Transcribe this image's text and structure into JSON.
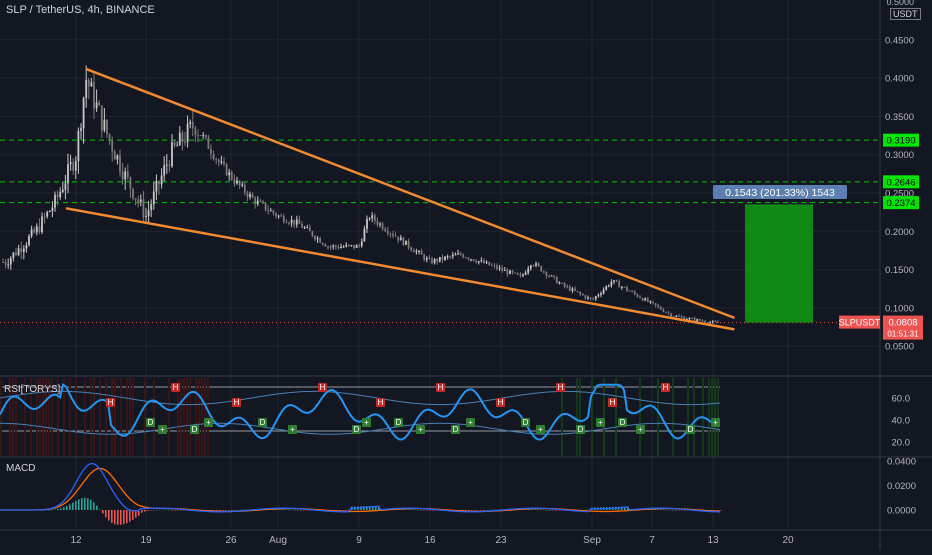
{
  "header": {
    "title": "SLP / TetherUS, 4h, BINANCE"
  },
  "price_axis": {
    "currency": "USDT",
    "ticks": [
      "0.4500",
      "0.4000",
      "0.3500",
      "0.3000",
      "0.2500",
      "0.2000",
      "0.1500",
      "0.1000",
      "0.0500"
    ],
    "tick_values": [
      0.45,
      0.4,
      0.35,
      0.3,
      0.25,
      0.2,
      0.15,
      0.1,
      0.05
    ],
    "top_partial": "0.5000"
  },
  "horizontal_levels": [
    {
      "value": "0.3190",
      "label_color": "#00e600"
    },
    {
      "value": "0.2646",
      "label_color": "#00e600"
    },
    {
      "value": "0.2374",
      "label_color": "#00e600"
    }
  ],
  "last_price": {
    "symbol": "SLPUSDT",
    "value": "0.0808",
    "countdown": "01:51:31",
    "color": "#ef5350"
  },
  "measure_label": "0.1543 (201.33%) 1543",
  "time_axis": [
    "12",
    "19",
    "26",
    "Aug",
    "9",
    "16",
    "23",
    "Sep",
    "7",
    "13",
    "20"
  ],
  "rsi_panel": {
    "title": "RSI[TORYS]",
    "ticks": [
      "60.0",
      "40.0",
      "20.0"
    ],
    "tick_values": [
      60,
      40,
      20
    ],
    "markers": [
      "H",
      "D",
      "+"
    ]
  },
  "macd_panel": {
    "title": "MACD",
    "ticks": [
      "0.0400",
      "0.0200",
      "0.0000"
    ],
    "tick_values": [
      0.04,
      0.02,
      0.0
    ]
  },
  "colors": {
    "background": "#131722",
    "up_candle": "#c7c7c7",
    "down_candle": "#7a7a7a",
    "trendline": "#f28b30",
    "level_line": "#00c800",
    "profit_zone": "#0f8a14",
    "rsi_line": "#2196f3",
    "macd_line": "#2962ff",
    "signal_line": "#ff6d00"
  },
  "chart_data": {
    "type": "candlestick",
    "symbol": "SLP / TetherUS",
    "timeframe": "4h",
    "exchange": "BINANCE",
    "ylim": [
      0.0,
      0.5
    ],
    "close_trace": [
      {
        "x": "Jul 5",
        "y": 0.16
      },
      {
        "x": "Jul 8",
        "y": 0.2
      },
      {
        "x": "Jul 10",
        "y": 0.24
      },
      {
        "x": "Jul 12",
        "y": 0.3
      },
      {
        "x": "Jul 13",
        "y": 0.4
      },
      {
        "x": "Jul 15",
        "y": 0.33
      },
      {
        "x": "Jul 17",
        "y": 0.27
      },
      {
        "x": "Jul 19",
        "y": 0.22
      },
      {
        "x": "Jul 21",
        "y": 0.3
      },
      {
        "x": "Jul 23",
        "y": 0.34
      },
      {
        "x": "Jul 25",
        "y": 0.29
      },
      {
        "x": "Jul 27",
        "y": 0.26
      },
      {
        "x": "Jul 29",
        "y": 0.24
      },
      {
        "x": "Aug 1",
        "y": 0.22
      },
      {
        "x": "Aug 3",
        "y": 0.21
      },
      {
        "x": "Aug 6",
        "y": 0.18
      },
      {
        "x": "Aug 9",
        "y": 0.18
      },
      {
        "x": "Aug 10",
        "y": 0.22
      },
      {
        "x": "Aug 13",
        "y": 0.19
      },
      {
        "x": "Aug 16",
        "y": 0.16
      },
      {
        "x": "Aug 19",
        "y": 0.17
      },
      {
        "x": "Aug 22",
        "y": 0.155
      },
      {
        "x": "Aug 25",
        "y": 0.14
      },
      {
        "x": "Aug 26",
        "y": 0.16
      },
      {
        "x": "Aug 29",
        "y": 0.13
      },
      {
        "x": "Sep 1",
        "y": 0.11
      },
      {
        "x": "Sep 3",
        "y": 0.135
      },
      {
        "x": "Sep 5",
        "y": 0.12
      },
      {
        "x": "Sep 7",
        "y": 0.105
      },
      {
        "x": "Sep 9",
        "y": 0.09
      },
      {
        "x": "Sep 11",
        "y": 0.085
      },
      {
        "x": "Sep 13",
        "y": 0.0808
      }
    ],
    "trendlines": [
      {
        "name": "upper",
        "from": {
          "x": "Jul 13",
          "y": 0.412
        },
        "to": {
          "x": "Sep 15",
          "y": 0.087
        }
      },
      {
        "name": "lower",
        "from": {
          "x": "Jul 11",
          "y": 0.23
        },
        "to": {
          "x": "Sep 15",
          "y": 0.072
        }
      }
    ],
    "levels": [
      0.319,
      0.2646,
      0.2374
    ],
    "target_zone": {
      "from_price": 0.0808,
      "to_price": 0.2351,
      "label": "0.1543 (201.33%) 1543"
    },
    "rsi": {
      "ylim": [
        10,
        75
      ],
      "overbought": 70,
      "oversold": 30
    },
    "macd": {
      "ylim": [
        -0.003,
        0.042
      ]
    }
  }
}
